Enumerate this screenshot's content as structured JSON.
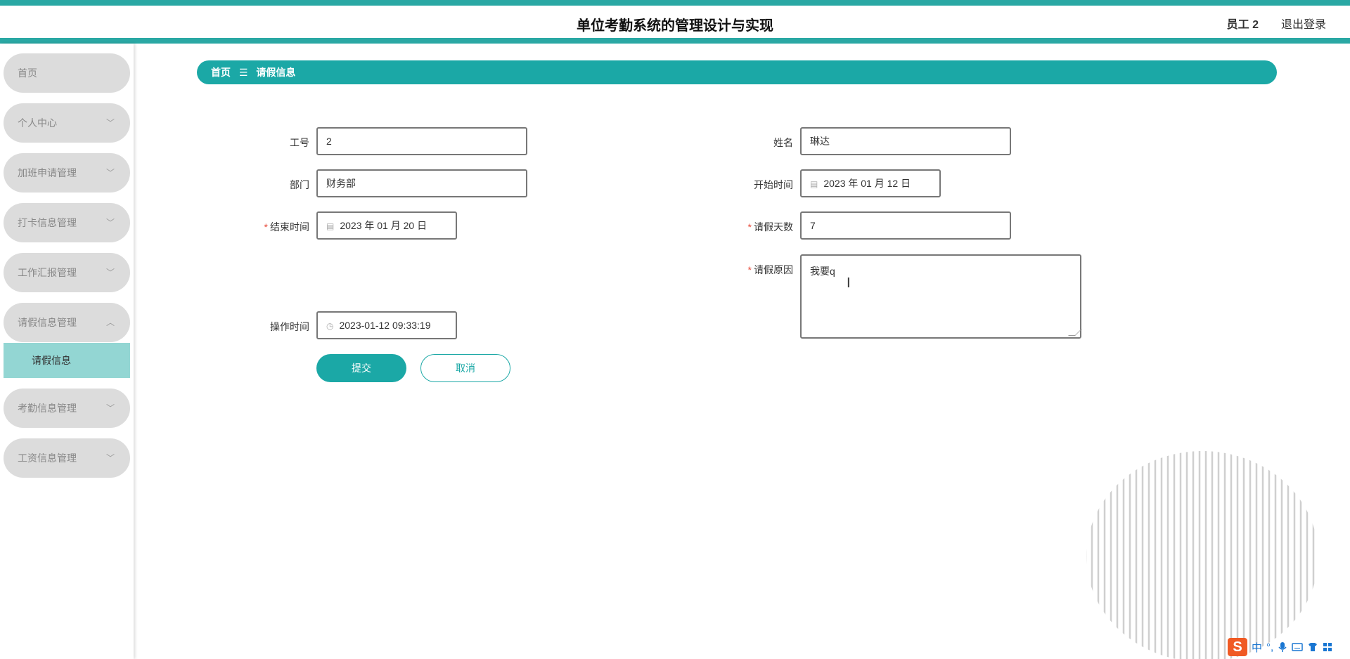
{
  "header": {
    "title": "单位考勤系统的管理设计与实现",
    "user": "员工 2",
    "logout": "退出登录"
  },
  "sidebar": {
    "items": [
      {
        "label": "首页",
        "chevron": ""
      },
      {
        "label": "个人中心",
        "chevron": "﹀"
      },
      {
        "label": "加班申请管理",
        "chevron": "﹀"
      },
      {
        "label": "打卡信息管理",
        "chevron": "﹀"
      },
      {
        "label": "工作汇报管理",
        "chevron": "﹀"
      },
      {
        "label": "请假信息管理",
        "chevron": "︿"
      },
      {
        "label": "考勤信息管理",
        "chevron": "﹀"
      },
      {
        "label": "工资信息管理",
        "chevron": "﹀"
      }
    ],
    "subitem": "请假信息"
  },
  "breadcrumb": {
    "home": "首页",
    "sep": "☰",
    "current": "请假信息"
  },
  "form": {
    "job_no_label": "工号",
    "job_no": "2",
    "name_label": "姓名",
    "name": "琳达",
    "dept_label": "部门",
    "dept": "财务部",
    "start_label": "开始时间",
    "start": "2023 年 01 月 12 日",
    "end_label": "结束时间",
    "end": "2023 年 01 月 20 日",
    "days_label": "请假天数",
    "days": "7",
    "reason_label": "请假原因",
    "reason": "我要q",
    "optime_label": "操作时间",
    "optime": "2023-01-12 09:33:19",
    "required_mark": "*",
    "submit": "提交",
    "cancel": "取消"
  },
  "ime": {
    "logo": "S",
    "mode": "中",
    "punct": "°,",
    "icons": [
      "microphone-icon",
      "keyboard-icon",
      "shirt-icon",
      "grid-icon"
    ]
  },
  "icons": {
    "calendar": "▤",
    "clock": "◷"
  },
  "colors": {
    "accent": "#1ba8a6",
    "header_border": "#2aa8a4",
    "active_submenu": "#93d6d3",
    "required": "#e74c3c"
  }
}
